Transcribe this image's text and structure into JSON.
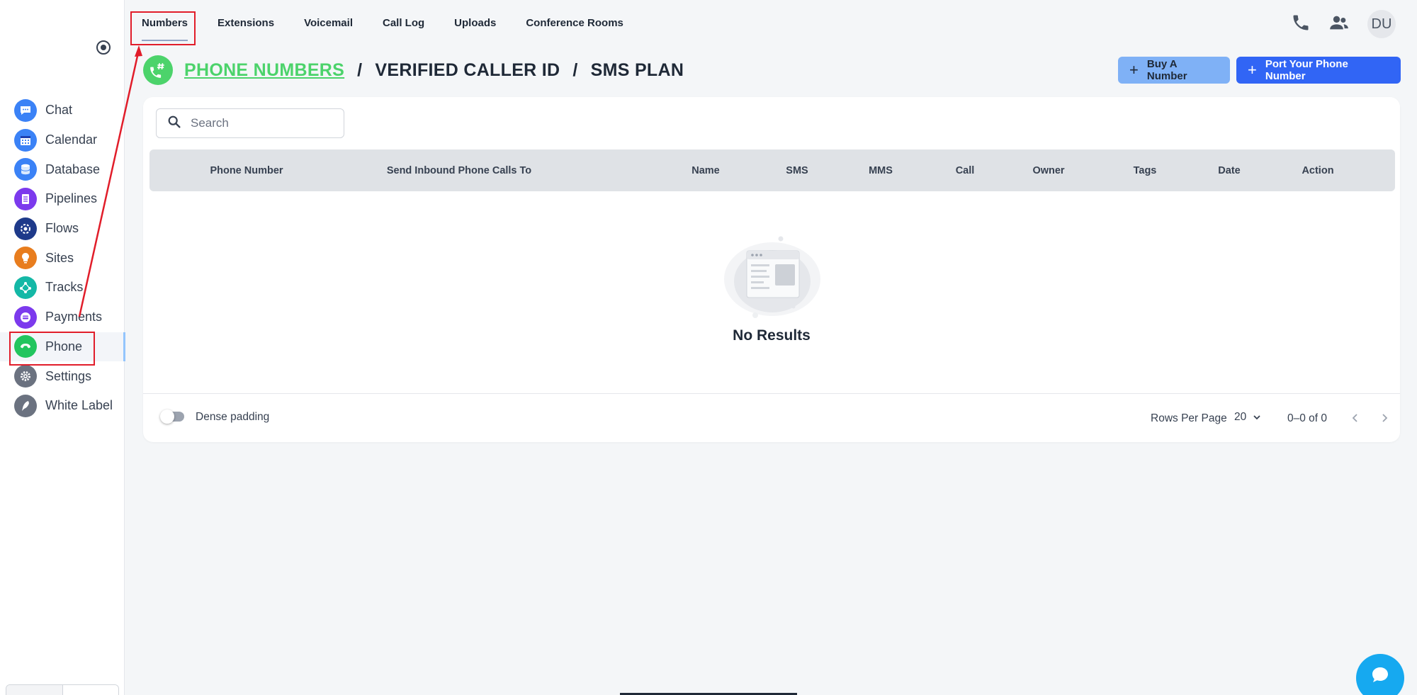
{
  "tabs": [
    {
      "label": "Numbers"
    },
    {
      "label": "Extensions"
    },
    {
      "label": "Voicemail"
    },
    {
      "label": "Call Log"
    },
    {
      "label": "Uploads"
    },
    {
      "label": "Conference Rooms"
    }
  ],
  "topbar": {
    "avatar_initials": "DU",
    "icons": [
      "phone-icon",
      "users-icon"
    ]
  },
  "sidebar": {
    "items": [
      {
        "label": "Chat",
        "icon": "chat-icon",
        "color": "#3b82f6"
      },
      {
        "label": "Calendar",
        "icon": "calendar-icon",
        "color": "#3b82f6"
      },
      {
        "label": "Database",
        "icon": "database-icon",
        "color": "#3b82f6"
      },
      {
        "label": "Pipelines",
        "icon": "pipelines-icon",
        "color": "#7c3aed"
      },
      {
        "label": "Flows",
        "icon": "flows-icon",
        "color": "#1e3a8a"
      },
      {
        "label": "Sites",
        "icon": "sites-icon",
        "color": "#e87d1e"
      },
      {
        "label": "Tracks",
        "icon": "tracks-icon",
        "color": "#14b8a6"
      },
      {
        "label": "Payments",
        "icon": "payments-icon",
        "color": "#7c3aed"
      },
      {
        "label": "Phone",
        "icon": "phone-icon",
        "color": "#22c55e",
        "active": true
      },
      {
        "label": "Settings",
        "icon": "settings-icon",
        "color": "#6b7280"
      },
      {
        "label": "White Label",
        "icon": "white-label-icon",
        "color": "#6b7280"
      }
    ]
  },
  "header": {
    "crumbs": [
      "PHONE NUMBERS",
      "VERIFIED CALLER ID",
      "SMS PLAN"
    ],
    "separator": "/",
    "icon": "phone-hash-icon"
  },
  "actions": {
    "buy_label": "Buy A Number",
    "port_label": "Port Your Phone Number"
  },
  "search": {
    "placeholder": "Search",
    "value": ""
  },
  "table": {
    "columns": [
      "Phone Number",
      "Send Inbound Phone Calls To",
      "Name",
      "SMS",
      "MMS",
      "Call",
      "Owner",
      "Tags",
      "Date",
      "Action"
    ],
    "rows": [],
    "empty_text": "No Results"
  },
  "footer": {
    "dense_label": "Dense padding",
    "dense_enabled": false,
    "rows_per_page_label": "Rows Per Page",
    "rows_per_page_value": "20",
    "range_text": "0–0 of 0"
  },
  "colors": {
    "accent_green": "#4cd36b",
    "primary_blue": "#3165f5",
    "light_blue": "#7fb1f6",
    "chat_fab": "#16a9f0",
    "annotation_red": "#e11d2a"
  }
}
